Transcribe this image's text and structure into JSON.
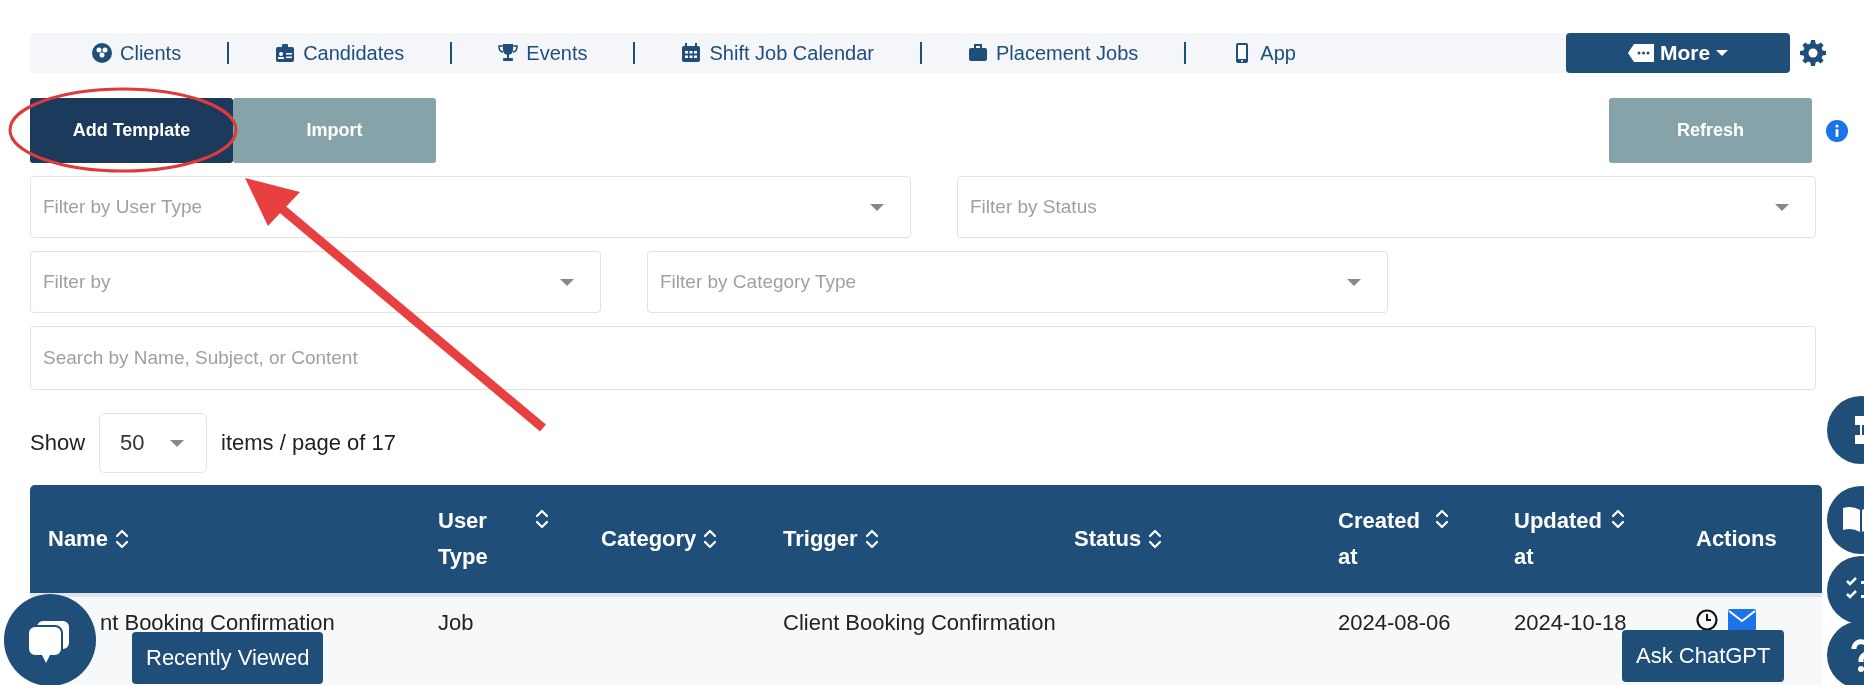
{
  "nav": {
    "items": [
      {
        "label": "Clients"
      },
      {
        "label": "Candidates"
      },
      {
        "label": "Events"
      },
      {
        "label": "Shift Job Calendar"
      },
      {
        "label": "Placement Jobs"
      },
      {
        "label": "App"
      }
    ],
    "more": {
      "label": "More"
    }
  },
  "toolbar": {
    "buttons": [
      {
        "label": "Add Template",
        "kind": "primary"
      },
      {
        "label": "Import",
        "kind": "secondary"
      }
    ],
    "refresh": {
      "label": "Refresh"
    }
  },
  "filters": [
    [
      {
        "placeholder": "Filter by User Type"
      },
      {
        "placeholder": "Filter by Status"
      }
    ],
    [
      {
        "placeholder": "Filter by"
      },
      {
        "placeholder": "Filter by Category Type"
      }
    ]
  ],
  "search": {
    "placeholder": "Search by Name, Subject, or Content"
  },
  "pagination": {
    "show_label": "Show",
    "page_size": "50",
    "suffix": "items / page of 17"
  },
  "table": {
    "columns": [
      {
        "label": "Name",
        "sortable": true
      },
      {
        "label": "User Type",
        "sortable": true
      },
      {
        "label": "Category",
        "sortable": true
      },
      {
        "label": "Trigger",
        "sortable": true
      },
      {
        "label": "Status",
        "sortable": true
      },
      {
        "label": "Created at",
        "sortable": true
      },
      {
        "label": "Updated at",
        "sortable": true
      },
      {
        "label": "Actions",
        "sortable": false
      }
    ],
    "rows": [
      {
        "name": "nt Booking Confirmation",
        "user_type": "Job",
        "trigger": "Client Booking Confirmation",
        "created_at": "2024-08-06",
        "updated_at": "2024-10-18"
      }
    ]
  },
  "overlays": {
    "recently_viewed": "Recently Viewed",
    "ask_chatgpt": "Ask ChatGPT"
  }
}
